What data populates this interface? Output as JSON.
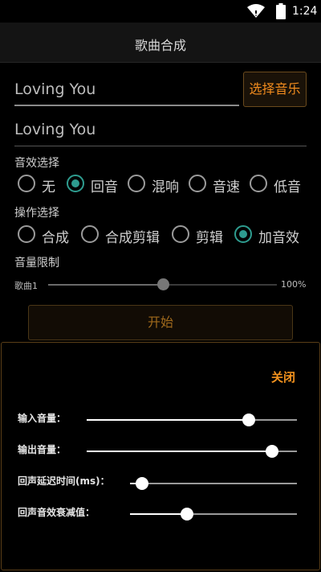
{
  "status": {
    "time": "1:24"
  },
  "app": {
    "title": "歌曲合成"
  },
  "song_input_1": {
    "value": "Loving You"
  },
  "song_input_2": {
    "value": "Loving You"
  },
  "select_music_button": "选择音乐",
  "effect_section": {
    "label": "音效选择",
    "options": [
      "无",
      "回音",
      "混响",
      "音速",
      "低音"
    ],
    "selected": "回音"
  },
  "operation_section": {
    "label": "操作选择",
    "options": [
      "合成",
      "合成剪辑",
      "剪辑",
      "加音效"
    ],
    "selected": "加音效"
  },
  "volume_limit": {
    "label": "音量限制",
    "track_label": "歌曲1",
    "percent": "100%",
    "level_fraction": 0.5
  },
  "start_button": "开始",
  "effect_panel": {
    "close_label": "关闭",
    "sliders": [
      {
        "label": "输入音量：",
        "level_fraction": 0.77
      },
      {
        "label": "输出音量：",
        "level_fraction": 0.88
      },
      {
        "label": "回声延迟时间(ms)：",
        "level_fraction": 0.07
      },
      {
        "label": "回声音效衰减值：",
        "level_fraction": 0.34
      }
    ]
  },
  "colors": {
    "accent": "#f2921e",
    "radio_checked": "#2e9c8f"
  }
}
